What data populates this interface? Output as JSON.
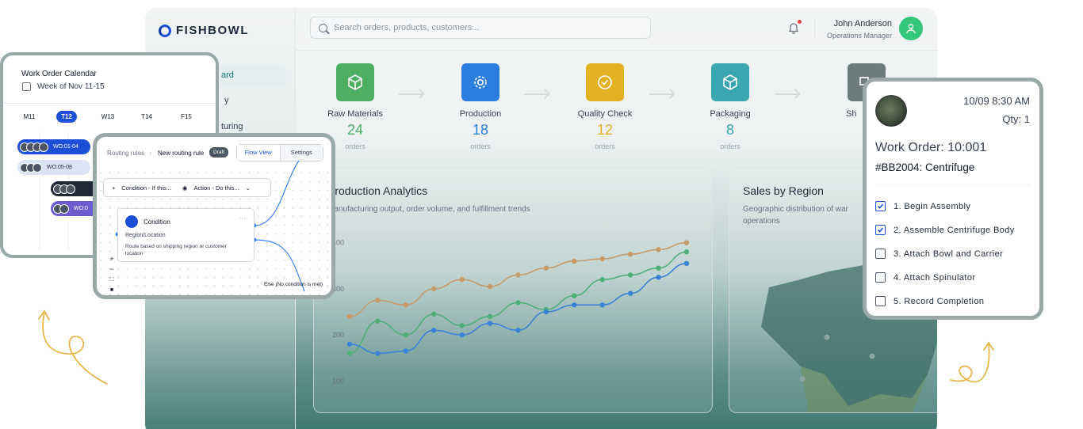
{
  "brand": {
    "name": "FISHBOWL"
  },
  "sidebar": {
    "items": [
      {
        "label": "ard"
      },
      {
        "label": "y"
      },
      {
        "label": "turing"
      }
    ]
  },
  "header": {
    "search_placeholder": "Search orders, products, customers...",
    "user_name": "John Anderson",
    "user_role": "Operations Manager"
  },
  "pipeline": [
    {
      "label": "Raw Materials",
      "count": "24",
      "unit": "orders",
      "color": "#4caf62",
      "icon": "box-icon"
    },
    {
      "label": "Production",
      "count": "18",
      "unit": "orders",
      "color": "#2b7de0",
      "icon": "gear-icon"
    },
    {
      "label": "Quality Check",
      "count": "12",
      "unit": "orders",
      "color": "#e3b224",
      "icon": "check-circle-icon"
    },
    {
      "label": "Packaging",
      "count": "8",
      "unit": "orders",
      "color": "#3aa6b0",
      "icon": "package-icon"
    },
    {
      "label": "Sh",
      "count": "",
      "unit": "",
      "color": "#6b7c7b",
      "icon": "truck-icon"
    }
  ],
  "analytics": {
    "title": "Production Analytics",
    "subtitle": "Manufacturing output, order volume, and fulfillment trends"
  },
  "sales": {
    "title": "Sales by Region",
    "subtitle_line1": "Geographic distribution of war",
    "subtitle_line2": "operations"
  },
  "chart_data": {
    "type": "line",
    "title": "Production Analytics",
    "y_ticks": [
      "400",
      "300",
      "200",
      "100"
    ],
    "ylim": [
      0,
      400
    ],
    "x": [
      1,
      2,
      3,
      4,
      5,
      6,
      7,
      8,
      9,
      10,
      11,
      12,
      13
    ],
    "series": [
      {
        "values": [
          240,
          275,
          265,
          300,
          320,
          305,
          330,
          345,
          360,
          365,
          375,
          385,
          400
        ],
        "color": "#c79a6a"
      },
      {
        "values": [
          160,
          230,
          200,
          245,
          220,
          240,
          270,
          255,
          285,
          320,
          330,
          345,
          380
        ],
        "color": "#4fae7a"
      },
      {
        "values": [
          180,
          160,
          165,
          210,
          200,
          225,
          210,
          250,
          265,
          265,
          290,
          325,
          355
        ],
        "color": "#3b82d6"
      }
    ]
  },
  "calendar": {
    "title": "Work Order Calendar",
    "week": "Week of Nov 11-15",
    "days": [
      "M11",
      "T12",
      "W13",
      "T14",
      "F15"
    ],
    "selected_day": "T12",
    "orders": [
      {
        "label": "WO:01-04"
      },
      {
        "label": "WO:05-08"
      },
      {
        "label": ""
      },
      {
        "label": "WO:0"
      }
    ]
  },
  "routing": {
    "crumb": "Routing rules",
    "title": "New routing rule",
    "badge": "Draft",
    "tab_flow": "Flow View",
    "tab_settings": "Settings",
    "condition_menu": "Condition - If this...",
    "action_menu": "Action - Do this...",
    "node_title": "Condition",
    "node_field": "Region/Location",
    "node_desc": "Route based on shipping region or customer location",
    "else_label": "Else (No condition is met)"
  },
  "work_order": {
    "date": "10/09 8:30 AM",
    "qty": "Qty: 1",
    "title": "Work Order: 10:001",
    "product": "#BB2004: Centrifuge",
    "steps": [
      {
        "label": "1. Begin Assembly",
        "checked": true
      },
      {
        "label": "2. Assemble Centrifuge Body",
        "checked": true
      },
      {
        "label": "3. Attach Bowl and Carrier",
        "checked": false
      },
      {
        "label": "4. Attach Spinulator",
        "checked": false
      },
      {
        "label": "5. Record Completion",
        "checked": false
      }
    ]
  }
}
